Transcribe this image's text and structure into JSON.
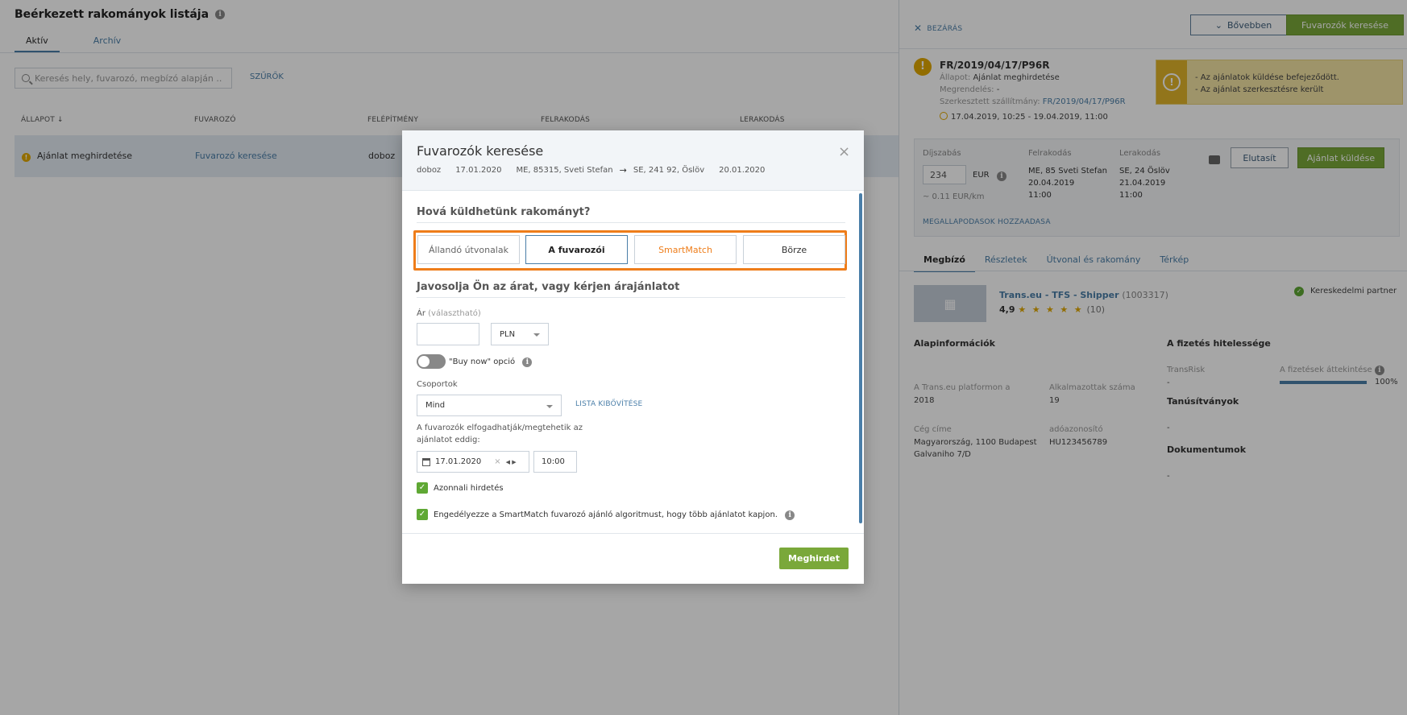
{
  "main": {
    "title": "Beérkezett rakományok listája",
    "tabs": [
      "Aktív",
      "Archív"
    ],
    "search_placeholder": "Keresés hely, fuvarozó, megbízó alapján ..",
    "filters_label": "SZŰRŐK",
    "columns": [
      "ÁLLAPOT ↓",
      "FUVAROZÓ",
      "FELÉPÍTMÉNY",
      "FELRAKODÁS",
      "LERAKODÁS"
    ],
    "row": {
      "status": "Ajánlat meghirdetése",
      "carrier": "Fuvarozó keresése",
      "body": "doboz"
    }
  },
  "panel": {
    "close_label": "BEZÁRÁS",
    "more_label": "Bővebben",
    "search_carriers_label": "Fuvarozók keresése",
    "ref": "FR/2019/04/17/P96R",
    "state_label": "Állapot:",
    "state_value": "Ajánlat meghirdetése",
    "order_label": "Megrendelés:",
    "order_value": "-",
    "edited_label": "Szerkesztett szállítmány:",
    "edited_value": "FR/2019/04/17/P96R",
    "date_range": "17.04.2019, 10:25 - 19.04.2019, 11:00",
    "notes": [
      "- Az ajánlatok küldése befejeződött.",
      "- Az ajánlat szerkesztésre került"
    ],
    "price": {
      "label": "Díjszabás",
      "value": "234",
      "currency": "EUR",
      "per_km": "~ 0.11 EUR/km",
      "loading_label": "Felrakodás",
      "loading_place": "ME, 85 Sveti Stefan",
      "loading_date": "20.04.2019",
      "loading_time": "11:00",
      "unloading_label": "Lerakodás",
      "unloading_place": "SE, 24 Öslöv",
      "unloading_date": "21.04.2019",
      "unloading_time": "11:00",
      "reject_label": "Elutasít",
      "send_offer_label": "Ajánlat küldése",
      "agreements_link": "MEGALLAPODASOK HOZZAADASA"
    },
    "tabs": [
      "Megbízó",
      "Részletek",
      "Útvonal és rakomány",
      "Térkép"
    ],
    "company": {
      "name": "Trans.eu - TFS - Shipper",
      "id": "(1003317)",
      "rating": "4,9",
      "stars": "★ ★ ★ ★ ★",
      "rating_count": "(10)",
      "partner_label": "Kereskedelmi partner"
    },
    "basic_info_title": "Alapinformációk",
    "platform_label": "A Trans.eu platformon a",
    "platform_value": "2018",
    "employees_label": "Alkalmazottak száma",
    "employees_value": "19",
    "address_label": "Cég címe",
    "address_line1": "Magyarország, 1100 Budapest",
    "address_line2": "Galvaniho 7/D",
    "tax_label": "adóazonosító",
    "tax_value": "HU123456789",
    "payment_title": "A fizetés hitelessége",
    "transrisk_label": "TransRisk",
    "transrisk_value": "-",
    "payment_review_label": "A fizetések áttekintése",
    "payment_review_value": "100%",
    "payment_review_fraction": 1.0,
    "certs_title": "Tanúsítványok",
    "certs_value": "-",
    "docs_title": "Dokumentumok",
    "docs_value": "-"
  },
  "modal": {
    "title": "Fuvarozók keresése",
    "close": "×",
    "route": {
      "body": "doboz",
      "load_date": "17.01.2020",
      "from": "ME, 85315, Sveti Stefan",
      "to": "SE, 241 92, Öslöv",
      "unload_date": "20.01.2020"
    },
    "where_title": "Hová küldhetünk rakományt?",
    "options": [
      "Állandó útvonalak",
      "A fuvarozói",
      "SmartMatch",
      "Börze"
    ],
    "price_title": "Javosolja Ön az árat, vagy kérjen árajánlatot",
    "price_label": "Ár",
    "price_optional": "(választható)",
    "currency": "PLN",
    "buy_now_label": "\"Buy now\" opció",
    "groups_label": "Csoportok",
    "groups_value": "Mind",
    "expand_list_label": "LISTA KIBŐVÍTÉSE",
    "deadline_label_1": "A fuvarozók elfogadhatják/megtehetik az",
    "deadline_label_2": "ajánlatot eddig:",
    "deadline_date": "17.01.2020",
    "deadline_time": "10:00",
    "immediate_label": "Azonnali hirdetés",
    "smartmatch_label": "Engedélyezze a SmartMatch fuvarozó ajánló algoritmust, hogy több ajánlatot kapjon.",
    "publish_label": "Meghirdet"
  }
}
